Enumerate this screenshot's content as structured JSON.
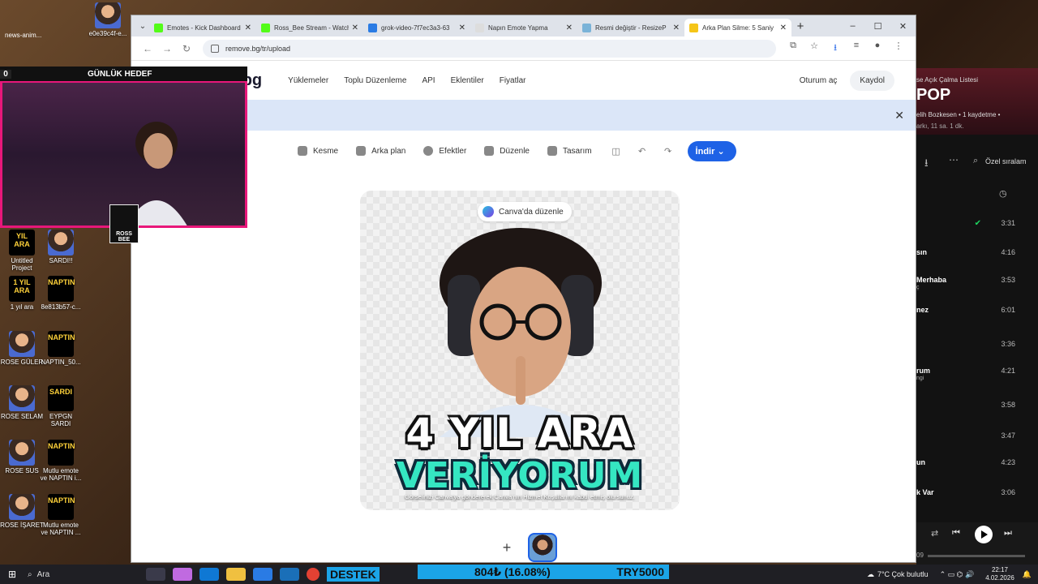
{
  "browser": {
    "tabs": [
      {
        "title": "Emotes - Kick Dashboard",
        "favicon_color": "#53fc18"
      },
      {
        "title": "Ross_Bee Stream - Watch",
        "favicon_color": "#53fc18"
      },
      {
        "title": "grok-video-7f7ec3a3-63",
        "favicon_color": "#2a7be4"
      },
      {
        "title": "Napın Emote Yapma",
        "favicon_color": "#dddddd"
      },
      {
        "title": "Resmi değiştir - ResizeP",
        "favicon_color": "#7ab3d8"
      },
      {
        "title": "Arka Plan Silme: 5 Saniy",
        "favicon_color": "#f5c518",
        "active": true
      }
    ],
    "url": "remove.bg/tr/upload"
  },
  "site": {
    "logo": "remove.bg",
    "nav": [
      "Yüklemeler",
      "Toplu Düzenleme",
      "API",
      "Eklentiler",
      "Fiyatlar"
    ],
    "login": "Oturum aç",
    "signup": "Kaydol",
    "tools": [
      "Kesme",
      "Arka plan",
      "Efektler",
      "Düzenle",
      "Tasarım"
    ],
    "download": "İndir",
    "canva_button": "Canva'da düzenle",
    "sticker_line1": "4 YIL ARA",
    "sticker_line2": "VERİYORUM",
    "terms": "Görselinizi Canva'ya göndererek Canva'nın Hizmet Koşullarını kabul etmiş olursunuz."
  },
  "stream_overlay": {
    "news": "news-anim...",
    "goal_label": "GÜNLÜK HEDEF",
    "goal_count": "0",
    "brand": "ROSS BEE"
  },
  "desktop_icons": [
    {
      "label": "e0e39c4f-e...",
      "art": ""
    },
    {
      "label": "Untitled Project",
      "art": "YIL ARA"
    },
    {
      "label": "SARDI!!",
      "art": ""
    },
    {
      "label": "1 yıl ara",
      "art": "1 YIL ARA"
    },
    {
      "label": "8e813b57-c...",
      "art": "NAPTIN"
    },
    {
      "label": "ROSE GÜLER",
      "art": ""
    },
    {
      "label": "NAPTIN_50...",
      "art": "NAPTIN"
    },
    {
      "label": "ROSE SELAM",
      "art": ""
    },
    {
      "label": "EYPGN SARDI",
      "art": "SARDI"
    },
    {
      "label": "ROSE SUS",
      "art": ""
    },
    {
      "label": "Mutlu emote ve NAPTIN i...",
      "art": "NAPTIN"
    },
    {
      "label": "ROSE İŞARET",
      "art": ""
    },
    {
      "label": "Mutlu emote ve NAPTIN ...",
      "art": "NAPTIN"
    }
  ],
  "spotify": {
    "header_small": "se Açık Çalma Listesi",
    "header_title": "POP",
    "owner": "elih Bozkesen • 1 kaydetme •",
    "meta": "arkı, 11 sa. 1 dk.",
    "sort": "Özel sıralam",
    "tracks": [
      {
        "name": "",
        "sub": "",
        "dur": "3:31"
      },
      {
        "name": "sın",
        "sub": "",
        "dur": "4:16"
      },
      {
        "name": "Merhaba",
        "sub": "ç",
        "dur": "3:53"
      },
      {
        "name": "nez",
        "sub": "",
        "dur": "6:01"
      },
      {
        "name": "",
        "sub": "",
        "dur": "3:36"
      },
      {
        "name": "rum",
        "sub": "ngi",
        "dur": "4:21"
      },
      {
        "name": "",
        "sub": "",
        "dur": "3:58"
      },
      {
        "name": "",
        "sub": "",
        "dur": "3:47"
      },
      {
        "name": "un",
        "sub": "",
        "dur": "4:23"
      },
      {
        "name": "k Var",
        "sub": "",
        "dur": "3:06"
      }
    ],
    "time": "09"
  },
  "taskbar": {
    "search": "Ara",
    "destek": "DESTEK",
    "ticker_value": "804₺ (16.08%)",
    "ticker_target": "TRY5000",
    "weather": "7°C  Çok bulutlu",
    "time": "22:17",
    "date": "4.02.2026"
  }
}
